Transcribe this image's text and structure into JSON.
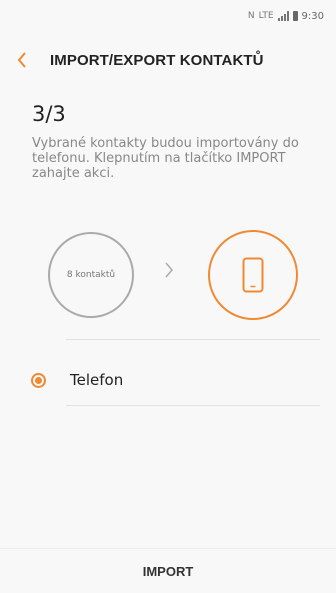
{
  "status_bar": {
    "time": "9:30",
    "network": "LTE"
  },
  "header": {
    "title": "IMPORT/EXPORT KONTAKTŮ"
  },
  "step": "3/3",
  "description": "Vybrané kontakty budou importovány do telefonu. Klepnutím na tlačítko IMPORT zahajte akci.",
  "transfer": {
    "source_label": "8 kontaktů"
  },
  "options": [
    {
      "label": "Telefon",
      "selected": true
    }
  ],
  "bottom": {
    "import_label": "IMPORT"
  },
  "colors": {
    "accent": "#f08a32"
  }
}
